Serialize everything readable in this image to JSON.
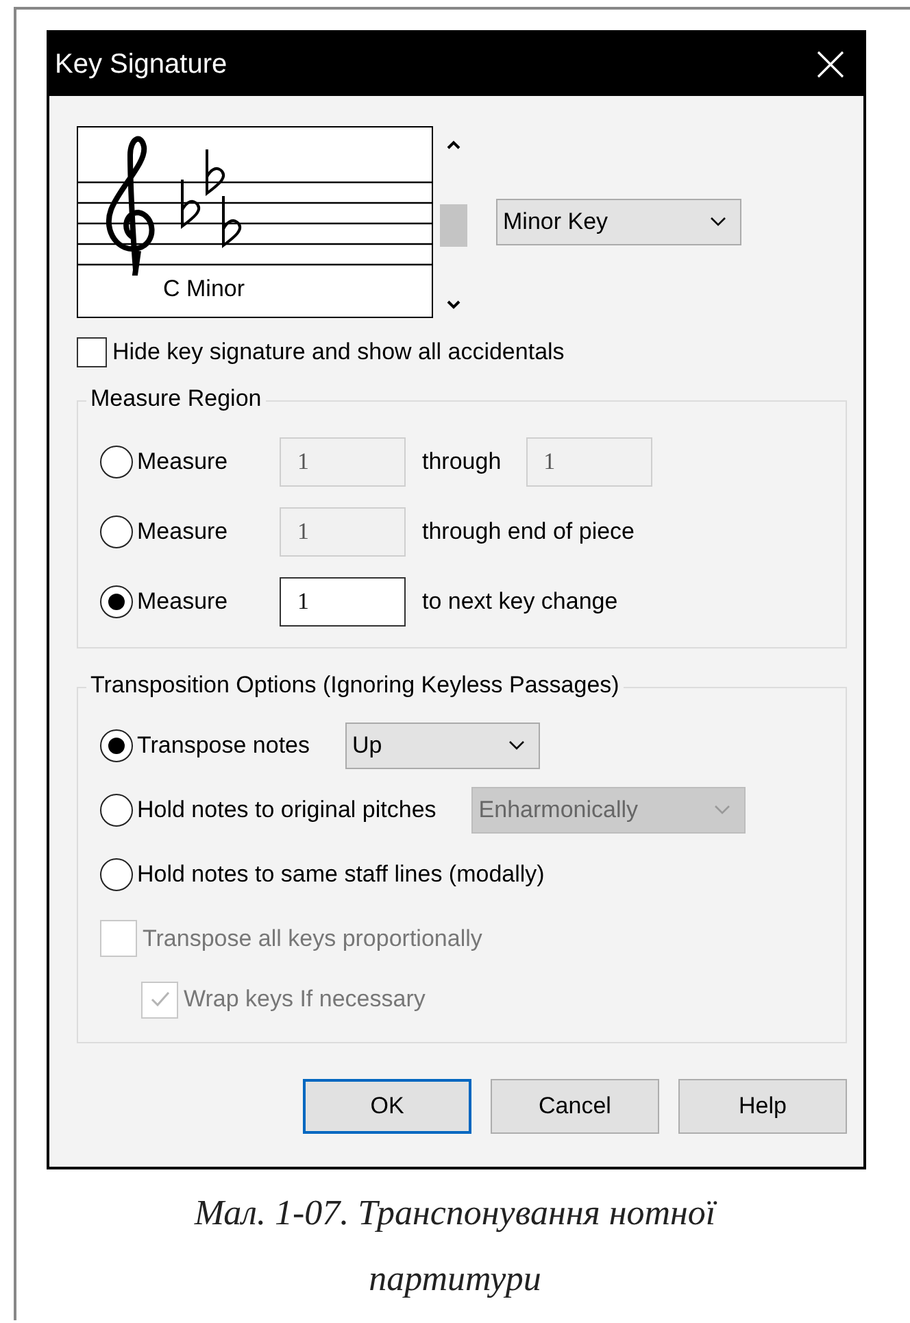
{
  "window": {
    "title": "Key Signature"
  },
  "key_preview": {
    "key_name": "C Minor"
  },
  "key_mode": {
    "value": "Minor Key"
  },
  "hide_key_signature": {
    "label": "Hide key signature and show all accidentals",
    "checked": false
  },
  "measure_region": {
    "title": "Measure Region",
    "rows": [
      {
        "label": "Measure",
        "selected": false,
        "from": "1",
        "from_disabled": true,
        "suffix": "through",
        "to": "1",
        "to_disabled": true
      },
      {
        "label": "Measure",
        "selected": false,
        "from": "1",
        "from_disabled": true,
        "suffix": "through end of piece"
      },
      {
        "label": "Measure",
        "selected": true,
        "from": "1",
        "from_disabled": false,
        "suffix": "to next key change"
      }
    ]
  },
  "transposition": {
    "title": "Transposition Options (Ignoring Keyless Passages)",
    "options": [
      {
        "kind": "radio",
        "label": "Transpose notes",
        "selected": true,
        "dropdown": {
          "value": "Up",
          "disabled": false
        }
      },
      {
        "kind": "radio",
        "label": "Hold notes to original pitches",
        "selected": false,
        "dropdown": {
          "value": "Enharmonically",
          "disabled": true
        }
      },
      {
        "kind": "radio",
        "label": "Hold notes to same staff lines (modally)",
        "selected": false
      },
      {
        "kind": "checkbox",
        "label": "Transpose all keys proportionally",
        "checked": false,
        "disabled": true,
        "indented": false
      },
      {
        "kind": "checkbox",
        "label": "Wrap keys If necessary",
        "checked": true,
        "disabled": true,
        "indented": true
      }
    ]
  },
  "buttons": [
    {
      "label": "OK",
      "default": true
    },
    {
      "label": "Cancel",
      "default": false
    },
    {
      "label": "Help",
      "default": false
    }
  ],
  "caption": "Мал. 1-07. Транспонування нотної партитури"
}
